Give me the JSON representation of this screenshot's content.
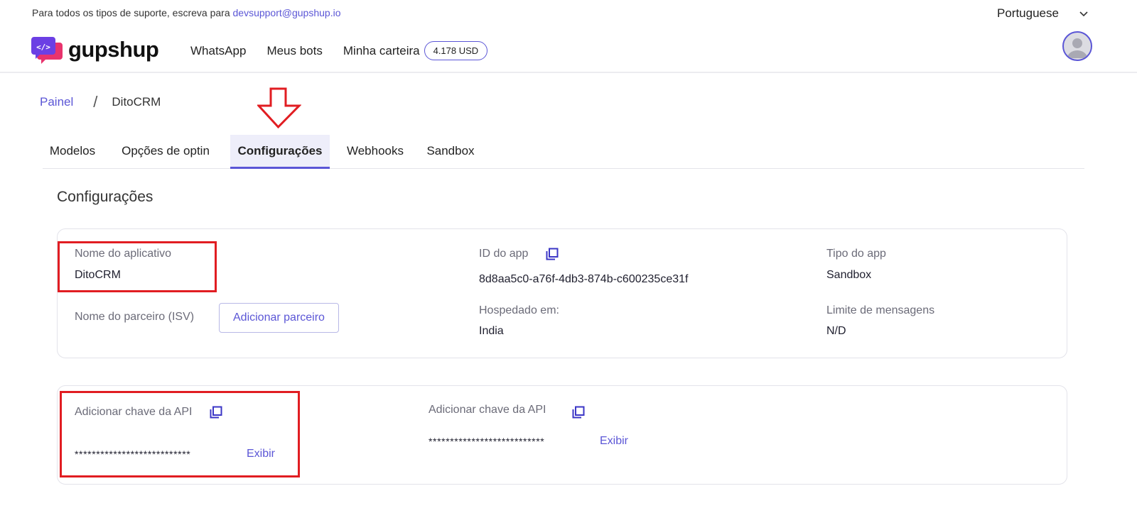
{
  "topbar": {
    "support_text": "Para todos os tipos de suporte, escreva para",
    "support_email": "devsupport@gupshup.io",
    "language": "Portuguese"
  },
  "brand": {
    "name": "gupshup",
    "logo_glyph": "</>"
  },
  "nav": {
    "items": [
      "WhatsApp",
      "Meus bots",
      "Minha carteira"
    ],
    "wallet_balance": "4.178 USD"
  },
  "breadcrumb": {
    "parent": "Painel",
    "separator": "/",
    "current": "DitoCRM"
  },
  "tabs": [
    {
      "label": "Modelos",
      "active": false
    },
    {
      "label": "Opções de optin",
      "active": false
    },
    {
      "label": "Configurações",
      "active": true
    },
    {
      "label": "Webhooks",
      "active": false
    },
    {
      "label": "Sandbox",
      "active": false
    }
  ],
  "section_title": "Configurações",
  "app_info": {
    "app_name_label": "Nome do aplicativo",
    "app_name": "DitoCRM",
    "partner_label": "Nome do parceiro (ISV)",
    "add_partner_button": "Adicionar parceiro",
    "app_id_label": "ID do app",
    "app_id": "8d8aa5c0-a76f-4db3-874b-c600235ce31f",
    "hosted_label": "Hospedado em:",
    "hosted_value": "India",
    "app_type_label": "Tipo do app",
    "app_type": "Sandbox",
    "msg_limit_label": "Limite de mensagens",
    "msg_limit": "N/D"
  },
  "api_keys": [
    {
      "label": "Adicionar chave da API",
      "masked": "***************************",
      "show_link": "Exibir"
    },
    {
      "label": "Adicionar chave da API",
      "masked": "***************************",
      "show_link": "Exibir"
    }
  ],
  "colors": {
    "accent": "#5b56d6",
    "highlight_red": "#e11d22",
    "active_tab_bg": "#eeeefa"
  }
}
